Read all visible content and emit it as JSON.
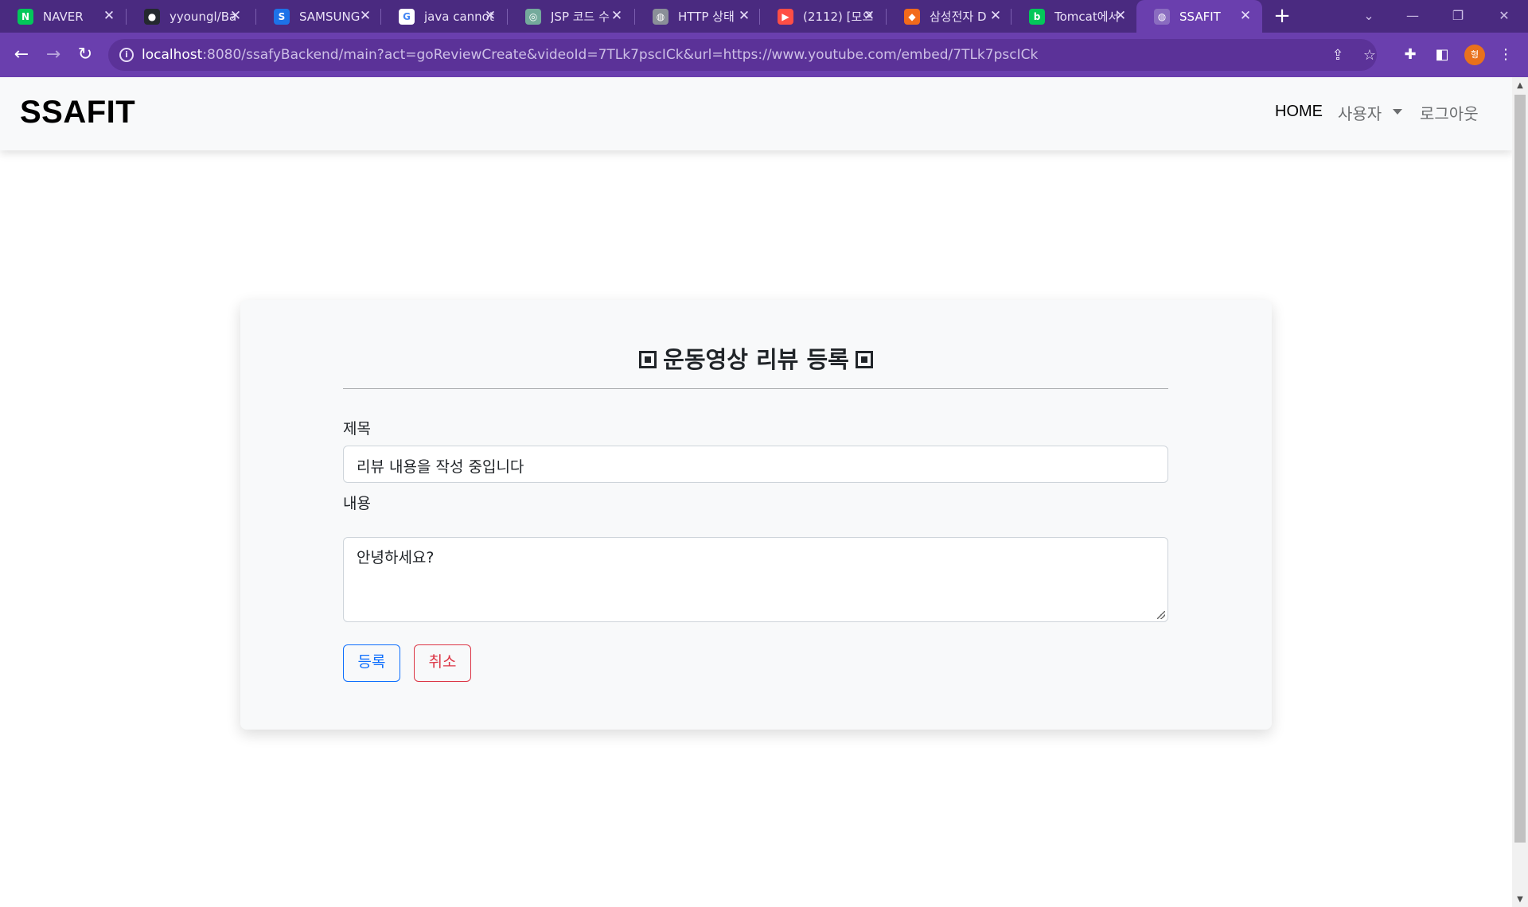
{
  "browser": {
    "tabs": [
      {
        "title": "NAVER",
        "favicon": "naver-icon",
        "color": "#03c75a",
        "glyph": "N"
      },
      {
        "title": "yyoungl/Ba",
        "favicon": "github-icon",
        "color": "#24292f",
        "glyph": "●"
      },
      {
        "title": "SAMSUNG",
        "favicon": "samsung-s-icon",
        "color": "#1d72e8",
        "glyph": "S"
      },
      {
        "title": "java cannot",
        "favicon": "google-icon",
        "color": "#ffffff",
        "glyph": "G"
      },
      {
        "title": "JSP 코드 수",
        "favicon": "chatgpt-icon",
        "color": "#74aa9c",
        "glyph": "◎"
      },
      {
        "title": "HTTP 상태",
        "favicon": "globe-icon",
        "color": "#8a8f98",
        "glyph": "◍"
      },
      {
        "title": "(2112) [모으",
        "favicon": "youtube-icon",
        "color": "#ff4e45",
        "glyph": "▶"
      },
      {
        "title": "삼성전자 D",
        "favicon": "swexpert-icon",
        "color": "#f26a1b",
        "glyph": "◆"
      },
      {
        "title": "Tomcat에서",
        "favicon": "naver-blog-icon",
        "color": "#03c75a",
        "glyph": "b"
      },
      {
        "title": "SSAFIT",
        "favicon": "globe-icon",
        "color": "#8a6cc0",
        "glyph": "◍"
      }
    ],
    "url_host": "localhost",
    "url_rest": ":8080/ssafyBackend/main?act=goReviewCreate&videoId=7TLk7pscICk&url=https://www.youtube.com/embed/7TLk7pscICk",
    "profile_initial": "형",
    "accent": "#6a3fae"
  },
  "navbar": {
    "brand": "SSAFIT",
    "home": "HOME",
    "user_menu": "사용자",
    "logout": "로그아웃"
  },
  "form": {
    "title": "운동영상 리뷰 등록",
    "title_label": "제목",
    "title_value": "리뷰 내용을 작성 중입니다",
    "content_label": "내용",
    "content_value": "안녕하세요?",
    "submit_label": "등록",
    "cancel_label": "취소",
    "primary_color": "#0d6efd",
    "danger_color": "#dc3545"
  }
}
